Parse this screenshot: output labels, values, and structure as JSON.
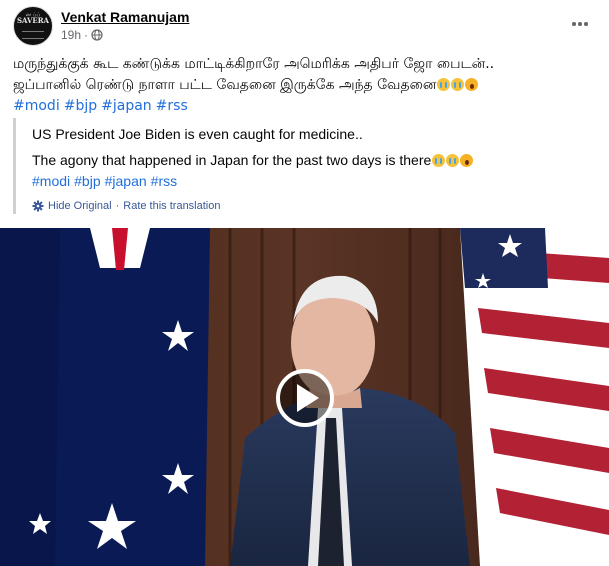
{
  "post": {
    "author": "Venkat Ramanujam",
    "time": "19h",
    "avatar_text": {
      "line1": "ஸ ப்ப்",
      "line2": "SAVERA"
    },
    "body_line1": "மருந்துக்குக் கூட கண்டுக்க  மாட்டிக்கிறாரே அமெரிக்க அதிபர் ஜோ பைடன்..",
    "body_line2": "ஜப்பானில் ரெண்டு நாளா பட்ட வேதனை இருக்கே அந்த வேதனை",
    "hashtags": [
      "#modi",
      "#bjp",
      "#japan",
      "#rss"
    ]
  },
  "translation": {
    "line1": "US President Joe Biden is even caught for medicine..",
    "line2": "The agony that happened in Japan for the past two days is there",
    "hashtags": [
      "#modi",
      "#bjp",
      "#japan",
      "#rss"
    ],
    "hide_original": "Hide Original",
    "separator": "·",
    "rate": "Rate this translation"
  },
  "icons": {
    "globe": "globe-icon",
    "more": "more-options-icon",
    "gear": "gear-icon",
    "play": "play-icon"
  },
  "colors": {
    "link": "#216fdb",
    "secondary_text": "#65676b",
    "translation_link": "#385898"
  }
}
